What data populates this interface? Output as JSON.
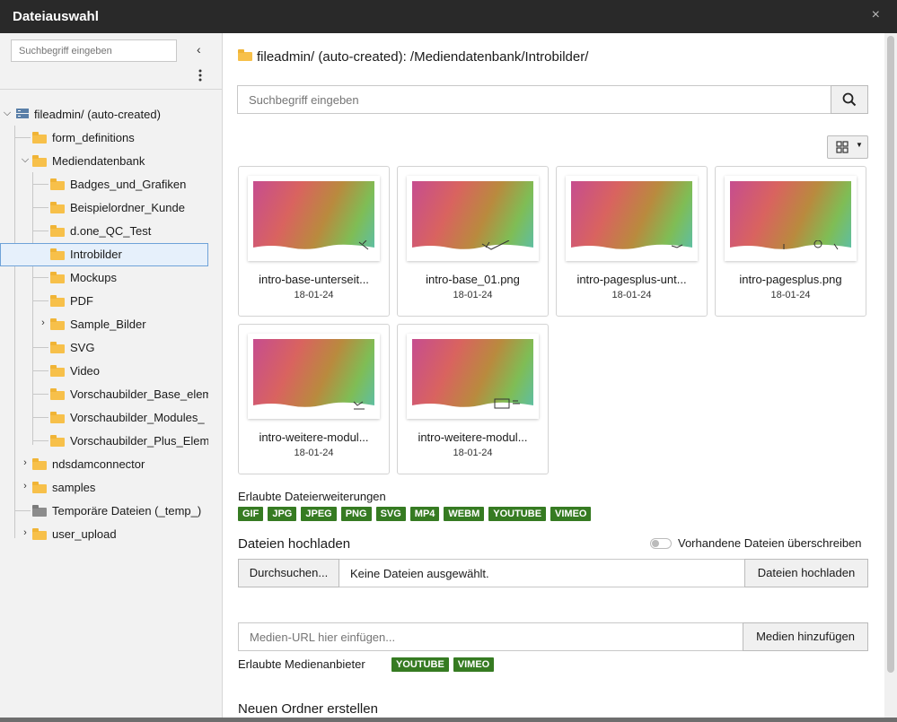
{
  "window": {
    "title": "Dateiauswahl",
    "close_glyph": "×"
  },
  "sidebar": {
    "search_placeholder": "Suchbegriff eingeben",
    "collapse_glyph": "‹",
    "menu_glyph": "⋮",
    "tree": [
      {
        "label": "fileadmin/ (auto-created)",
        "icon": "storage-icon",
        "toggle": "expanded"
      },
      {
        "label": "form_definitions",
        "icon": "folder-icon"
      },
      {
        "label": "Mediendatenbank",
        "icon": "folder-icon",
        "toggle": "expanded"
      },
      {
        "label": "Badges_und_Grafiken",
        "icon": "folder-icon"
      },
      {
        "label": "Beispielordner_Kunde",
        "icon": "folder-icon"
      },
      {
        "label": "d.one_QC_Test",
        "icon": "folder-icon"
      },
      {
        "label": "Introbilder",
        "icon": "folder-icon",
        "selected": true
      },
      {
        "label": "Mockups",
        "icon": "folder-icon"
      },
      {
        "label": "PDF",
        "icon": "folder-icon"
      },
      {
        "label": "Sample_Bilder",
        "icon": "folder-icon",
        "toggle": "collapsed"
      },
      {
        "label": "SVG",
        "icon": "folder-icon"
      },
      {
        "label": "Video",
        "icon": "folder-icon"
      },
      {
        "label": "Vorschaubilder_Base_elements",
        "icon": "folder-icon"
      },
      {
        "label": "Vorschaubilder_Modules_",
        "icon": "folder-icon"
      },
      {
        "label": "Vorschaubilder_Plus_Elements",
        "icon": "folder-icon"
      },
      {
        "label": "ndsdamconnector",
        "icon": "folder-icon",
        "toggle": "collapsed"
      },
      {
        "label": "samples",
        "icon": "folder-icon",
        "toggle": "collapsed"
      },
      {
        "label": "Temporäre Dateien (_temp_)",
        "icon": "temp-folder-icon"
      },
      {
        "label": "user_upload",
        "icon": "folder-icon",
        "toggle": "collapsed"
      }
    ]
  },
  "main": {
    "breadcrumb": "fileadmin/ (auto-created): /Mediendatenbank/Introbilder/",
    "search_placeholder": "Suchbegriff eingeben",
    "files": [
      {
        "name": "intro-base-unterseit...",
        "date": "18-01-24"
      },
      {
        "name": "intro-base_01.png",
        "date": "18-01-24"
      },
      {
        "name": "intro-pagesplus-unt...",
        "date": "18-01-24"
      },
      {
        "name": "intro-pagesplus.png",
        "date": "18-01-24"
      },
      {
        "name": "intro-weitere-modul...",
        "date": "18-01-24"
      },
      {
        "name": "intro-weitere-modul...",
        "date": "18-01-24"
      }
    ],
    "allowed_ext_label": "Erlaubte Dateierweiterungen",
    "allowed_ext": [
      "GIF",
      "JPG",
      "JPEG",
      "PNG",
      "SVG",
      "MP4",
      "WEBM",
      "YOUTUBE",
      "VIMEO"
    ],
    "upload_heading": "Dateien hochladen",
    "overwrite_label": "Vorhandene Dateien überschreiben",
    "browse_label": "Durchsuchen...",
    "no_files_label": "Keine Dateien ausgewählt.",
    "upload_button": "Dateien hochladen",
    "media_url_placeholder": "Medien-URL hier einfügen...",
    "add_media_button": "Medien hinzufügen",
    "providers_label": "Erlaubte Medienanbieter",
    "providers": [
      "YOUTUBE",
      "VIMEO"
    ],
    "new_folder_heading": "Neuen Ordner erstellen"
  },
  "colors": {
    "badge_green": "#367b22",
    "titlebar": "#292929",
    "folder": "#f7c04a",
    "selection": "#e6f0fb"
  }
}
